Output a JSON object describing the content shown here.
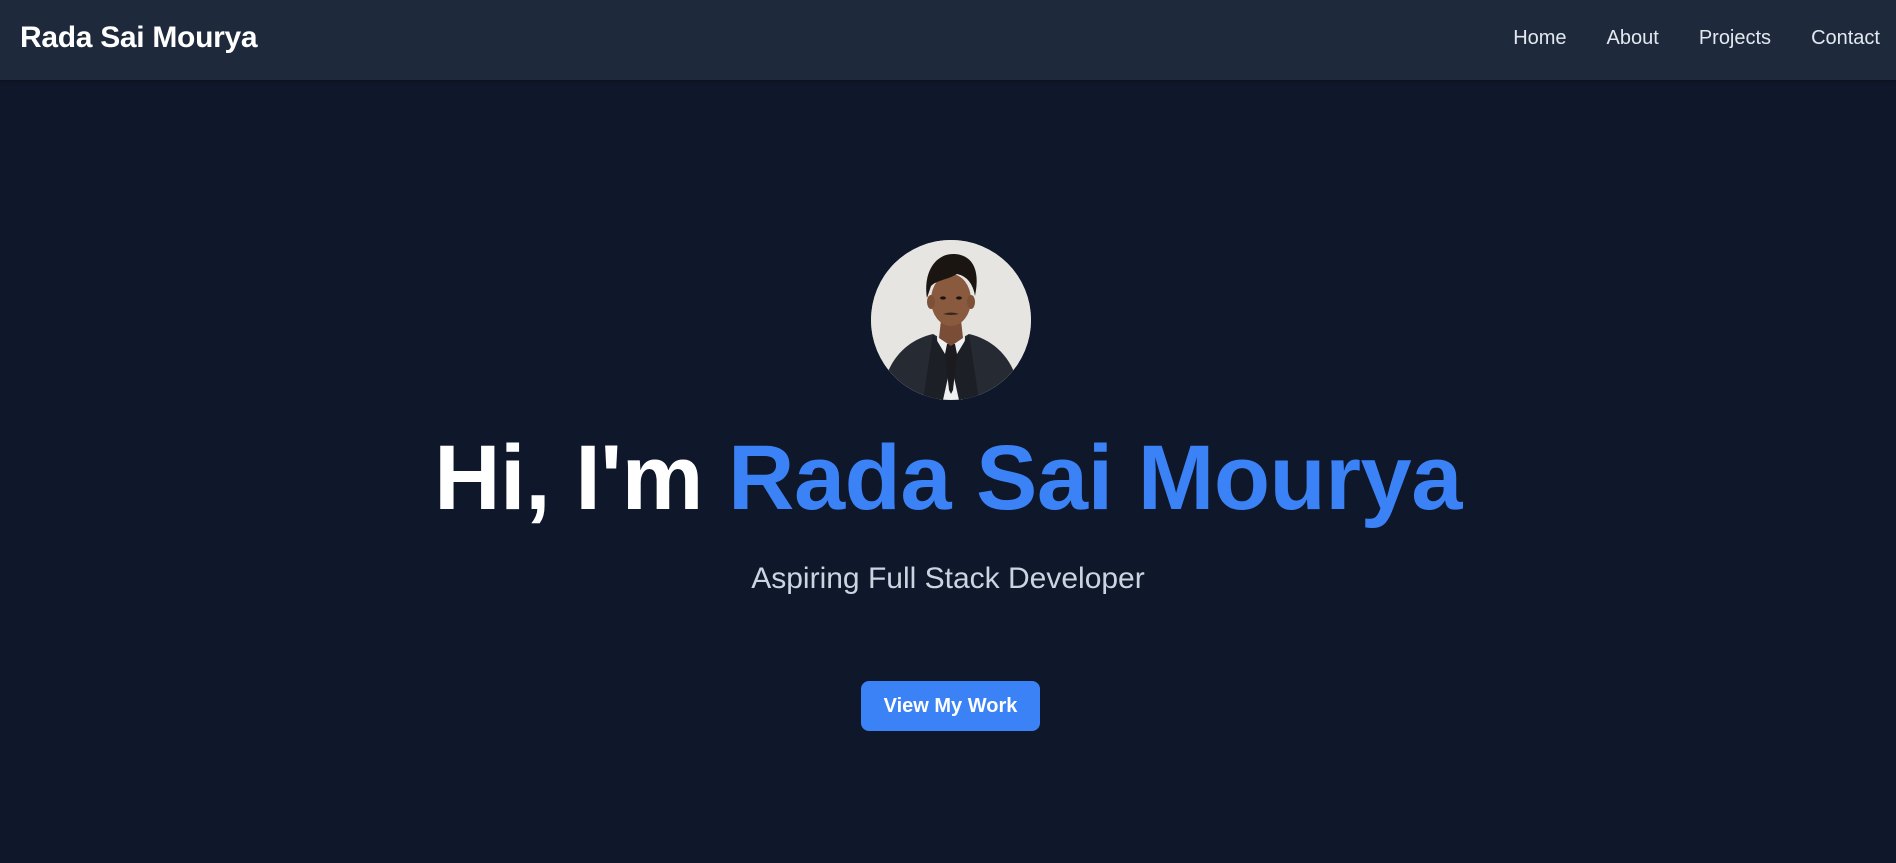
{
  "navbar": {
    "brand": "Rada Sai Mourya",
    "links": [
      {
        "label": "Home"
      },
      {
        "label": "About"
      },
      {
        "label": "Projects"
      },
      {
        "label": "Contact"
      }
    ]
  },
  "hero": {
    "avatar_alt": "Profile photo",
    "title_prefix": "Hi, I'm ",
    "title_name": "Rada Sai Mourya",
    "subtitle": "Aspiring Full Stack Developer",
    "cta_label": "View My Work"
  },
  "colors": {
    "background": "#0f172a",
    "navbar": "#1e293b",
    "accent": "#3b82f6",
    "subtitle": "#cbd5e1"
  }
}
